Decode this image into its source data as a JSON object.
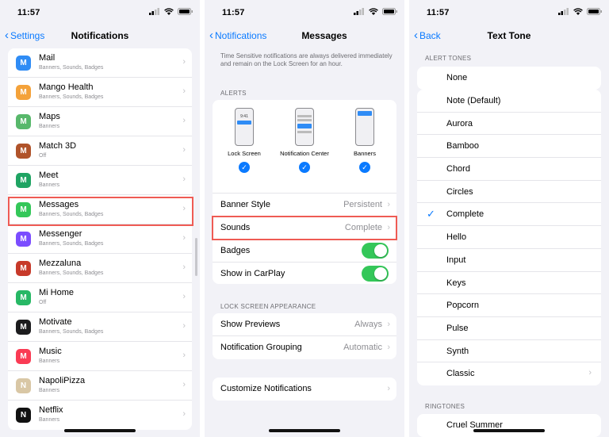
{
  "panel1": {
    "time": "11:57",
    "back": "Settings",
    "title": "Notifications",
    "apps": [
      {
        "name": "Mail",
        "sub": "Banners, Sounds, Badges",
        "color": "#2f8cf5",
        "icon": "mail-icon"
      },
      {
        "name": "Mango Health",
        "sub": "Banners, Sounds, Badges",
        "color": "#f4a23a",
        "icon": "mango-health-icon"
      },
      {
        "name": "Maps",
        "sub": "Banners",
        "color": "#58b86b",
        "icon": "maps-icon"
      },
      {
        "name": "Match 3D",
        "sub": "Off",
        "color": "#b0532a",
        "icon": "match-3d-icon"
      },
      {
        "name": "Meet",
        "sub": "Banners",
        "color": "#1fa463",
        "icon": "meet-icon"
      },
      {
        "name": "Messages",
        "sub": "Banners, Sounds, Badges",
        "color": "#34c759",
        "icon": "messages-icon"
      },
      {
        "name": "Messenger",
        "sub": "Banners, Sounds, Badges",
        "color": "#7b4dff",
        "icon": "messenger-icon"
      },
      {
        "name": "Mezzaluna",
        "sub": "Banners, Sounds, Badges",
        "color": "#c73a2a",
        "icon": "mezzaluna-icon"
      },
      {
        "name": "Mi Home",
        "sub": "Off",
        "color": "#27b865",
        "icon": "mi-home-icon"
      },
      {
        "name": "Motivate",
        "sub": "Banners, Sounds, Badges",
        "color": "#1c1c1e",
        "icon": "motivate-icon"
      },
      {
        "name": "Music",
        "sub": "Banners",
        "color": "#fa3b54",
        "icon": "music-icon"
      },
      {
        "name": "NapoliPizza",
        "sub": "Banners",
        "color": "#d9c7a5",
        "icon": "napolipizza-icon"
      },
      {
        "name": "Netflix",
        "sub": "Banners",
        "color": "#111111",
        "icon": "netflix-icon"
      }
    ]
  },
  "panel2": {
    "time": "11:57",
    "back": "Notifications",
    "title": "Messages",
    "note": "Time Sensitive notifications are always delivered immediately and remain on the Lock Screen for an hour.",
    "alerts_header": "ALERTS",
    "alert_options": [
      {
        "label": "Lock Screen",
        "mock_time": "9:41"
      },
      {
        "label": "Notification Center"
      },
      {
        "label": "Banners"
      }
    ],
    "banner_style_label": "Banner Style",
    "banner_style_value": "Persistent",
    "sounds_label": "Sounds",
    "sounds_value": "Complete",
    "badges_label": "Badges",
    "carplay_label": "Show in CarPlay",
    "lock_header": "LOCK SCREEN APPEARANCE",
    "previews_label": "Show Previews",
    "previews_value": "Always",
    "grouping_label": "Notification Grouping",
    "grouping_value": "Automatic",
    "customize_label": "Customize Notifications",
    "accent": "#0a7aff",
    "toggle_on_color": "#34c759"
  },
  "panel3": {
    "time": "11:57",
    "back": "Back",
    "title": "Text Tone",
    "alert_tones_header": "ALERT TONES",
    "none_label": "None",
    "tones": [
      "Note (Default)",
      "Aurora",
      "Bamboo",
      "Chord",
      "Circles",
      "Complete",
      "Hello",
      "Input",
      "Keys",
      "Popcorn",
      "Pulse",
      "Synth",
      "Classic"
    ],
    "selected": "Complete",
    "ringtones_header": "RINGTONES",
    "ringtone_first": "Cruel Summer"
  },
  "highlight_color": "#ef5b54"
}
